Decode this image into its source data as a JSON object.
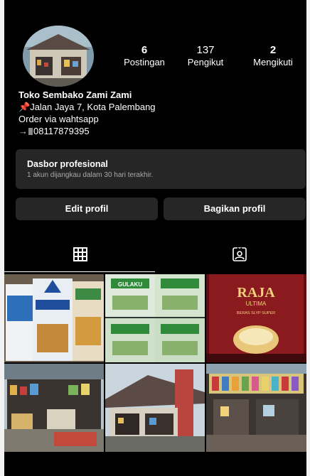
{
  "profile": {
    "stats": {
      "posts_count": "6",
      "posts_label": "Postingan",
      "followers_count": "137",
      "followers_label": "Pengikut",
      "following_count": "2",
      "following_label": "Mengikuti"
    },
    "name": "Toko Sembako Zami Zami",
    "address": "Jalan Jaya 7, Kota Palembang",
    "order_note": "Order via wahtsapp",
    "phone": "08117879395"
  },
  "dashboard": {
    "title": "Dasbor profesional",
    "subtitle": "1 akun dijangkau dalam 30 hari terakhir."
  },
  "buttons": {
    "edit_profile": "Edit profil",
    "share_profile": "Bagikan profil"
  },
  "grid": {
    "tile_texts": {
      "raja_brand": "RAJA",
      "raja_sub": "ULTIMA",
      "raja_tag": "BERAS SLYP SUPER",
      "gulaku": "GULAKU"
    }
  },
  "colors": {
    "background": "#000000",
    "surface": "#262626",
    "muted_text": "#a8a8a8",
    "pin": "#e3404e"
  },
  "icons": [
    "pin-icon",
    "phone-icon",
    "grid-icon",
    "tagged-icon"
  ]
}
